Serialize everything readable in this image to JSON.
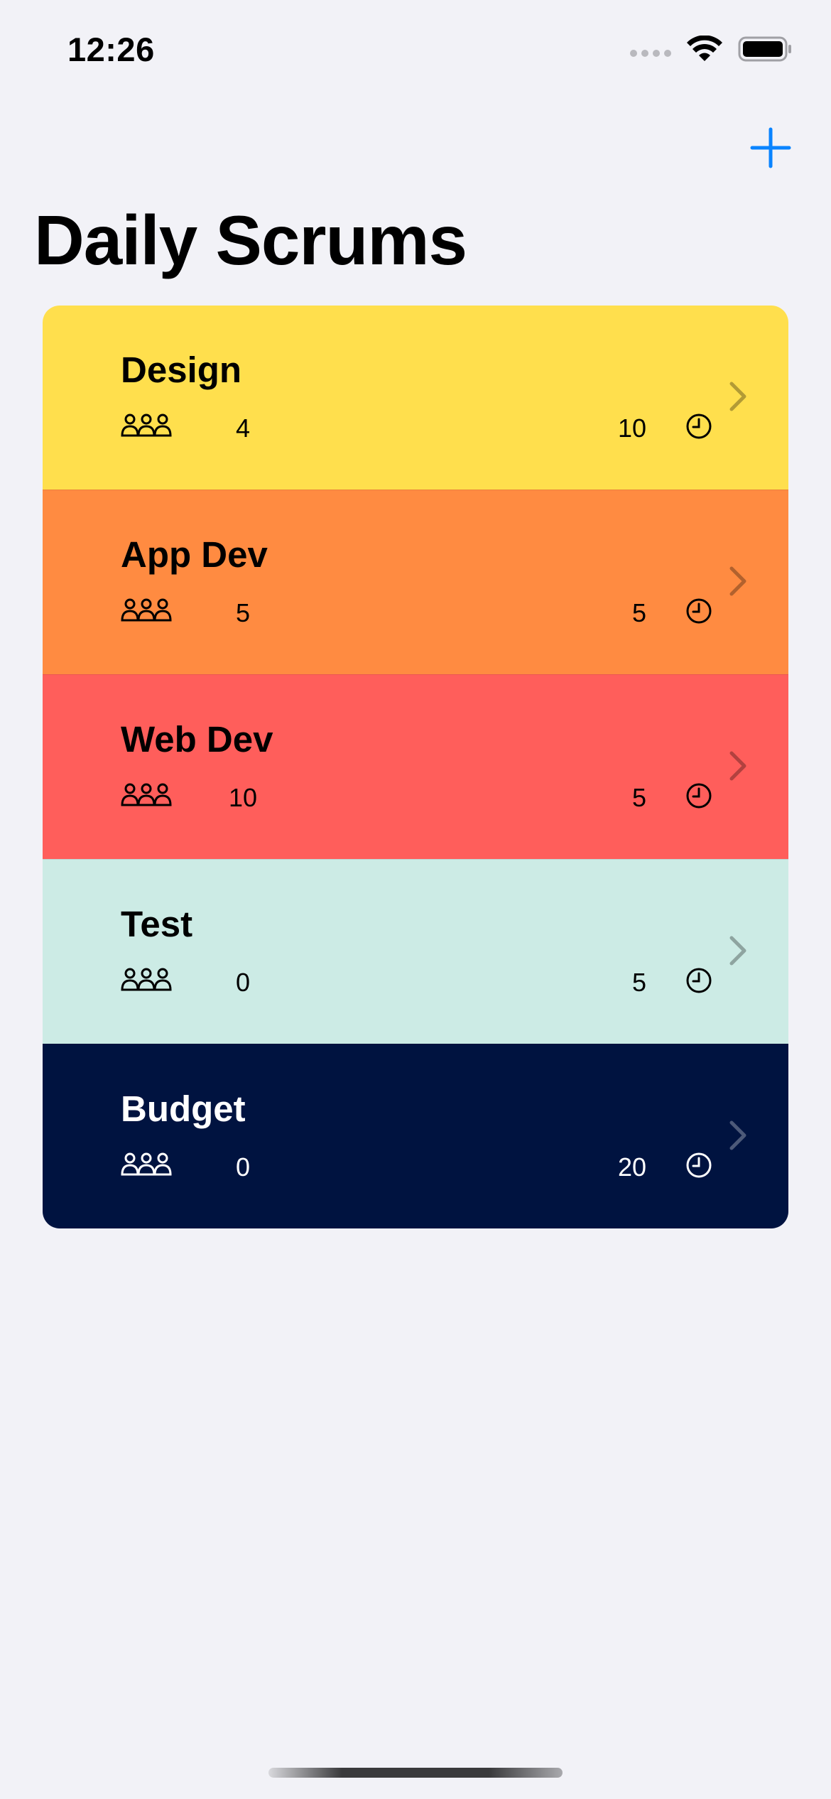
{
  "status_bar": {
    "time": "12:26"
  },
  "header": {
    "title": "Daily Scrums",
    "add_icon": "plus-icon"
  },
  "scrums": [
    {
      "title": "Design",
      "attendees": "4",
      "duration": "10",
      "theme_color": "#ffdf4d",
      "text_color": "#000000"
    },
    {
      "title": "App Dev",
      "attendees": "5",
      "duration": "5",
      "theme_color": "#ff8b41",
      "text_color": "#000000"
    },
    {
      "title": "Web Dev",
      "attendees": "10",
      "duration": "5",
      "theme_color": "#ff5e5b",
      "text_color": "#000000"
    },
    {
      "title": "Test",
      "attendees": "0",
      "duration": "5",
      "theme_color": "#ccebe5",
      "text_color": "#000000"
    },
    {
      "title": "Budget",
      "attendees": "0",
      "duration": "20",
      "theme_color": "#001340",
      "text_color": "#ffffff"
    }
  ],
  "colors": {
    "accent": "#0a84ff",
    "background": "#f2f2f7"
  },
  "icons": {
    "attendees": "person-3-icon",
    "duration": "clock-icon",
    "disclosure": "chevron-right-icon"
  }
}
